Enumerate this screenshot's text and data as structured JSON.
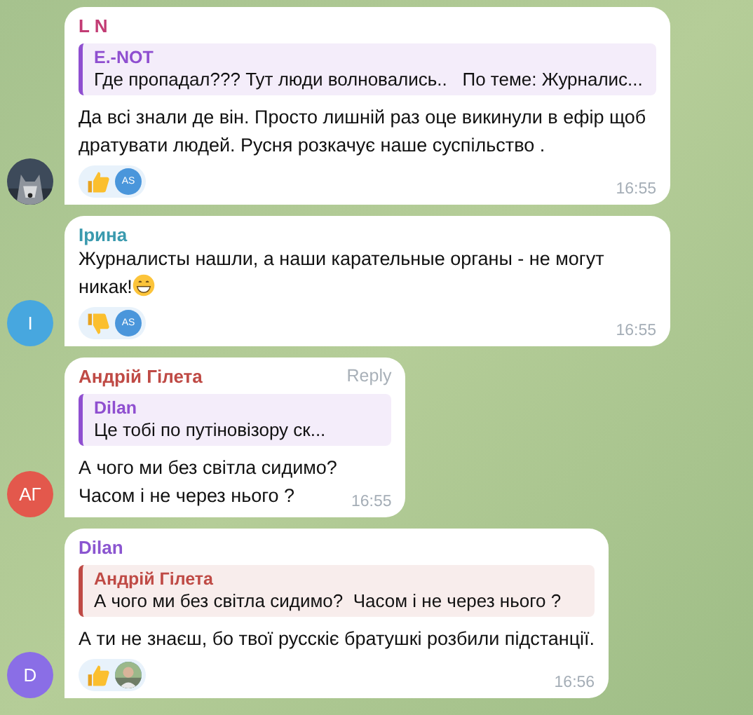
{
  "messages": [
    {
      "author": "L N",
      "color": "#c23c74",
      "reply": {
        "author": "E.-NOT",
        "text": "Где пропадал??? Тут люди волновались..   По теме: Журналис...",
        "color": "#8f4fd0"
      },
      "text": "Да всі знали де він. Просто лишній раз оце викинули в ефір щоб дратувати людей. Русня розкачує наше суспільство .",
      "reactions": [
        {
          "kind": "thumbs-up",
          "reactor": {
            "kind": "initials",
            "initials": "AS"
          }
        }
      ],
      "time": "16:55"
    },
    {
      "author": "Ірина",
      "color": "#3a9aae",
      "avatar": {
        "kind": "initials",
        "initials": "I",
        "color": "#47a7df"
      },
      "text": "Журналисты нашли, а наши карательные органы - не могут никак!",
      "emojis": [
        {
          "kind": "grin"
        }
      ],
      "reactions": [
        {
          "kind": "thumbs-down",
          "reactor": {
            "kind": "initials",
            "initials": "AS"
          }
        }
      ],
      "time": "16:55"
    },
    {
      "author": "Андрій Гілета",
      "color": "#bf4a45",
      "reply_link": "Reply",
      "avatar": {
        "kind": "initials",
        "initials": "АГ",
        "color": "#e3584c"
      },
      "reply": {
        "author": "Dilan",
        "text": "Це тобі по путіновізору ск...",
        "color": "#8f4fd0"
      },
      "text": "А чого ми без світла сидимо?\nЧасом і не через нього ?",
      "time": "16:55"
    },
    {
      "author": "Dilan",
      "color": "#8b55d0",
      "avatar": {
        "kind": "initials",
        "initials": "D",
        "color": "#8a6ee6"
      },
      "reply": {
        "author": "Андрій Гілета",
        "text": "А чого ми без світла сидимо?  Часом і не через нього ?",
        "color": "#bf4a45"
      },
      "text": "А ти не знаєш, бо твої русскіє братушкі розбили підстанції.",
      "reactions": [
        {
          "kind": "thumbs-up"
        }
      ],
      "time": "16:56"
    }
  ]
}
